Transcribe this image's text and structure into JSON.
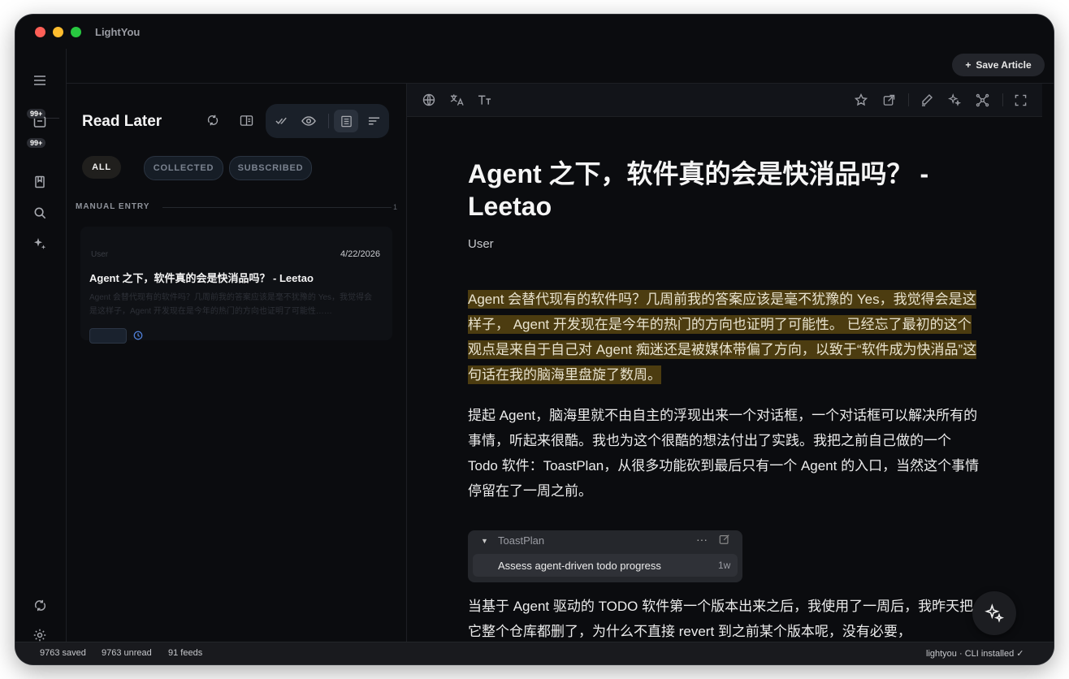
{
  "app": {
    "title": "LightYou"
  },
  "rail": {
    "badge_1": "99+",
    "badge_2": "99+"
  },
  "header": {
    "save_article_label": "Save Article"
  },
  "list": {
    "title": "Read Later",
    "filters": [
      "ALL",
      "COLLECTED",
      "SUBSCRIBED"
    ],
    "section": {
      "label": "MANUAL ENTRY",
      "count": "1"
    },
    "items": [
      {
        "source": "User",
        "date": "4/22/2026",
        "title": "Agent 之下，软件真的会是快消品吗？ - Leetao",
        "excerpt": "Agent 会替代现有的软件吗？几周前我的答案应该是毫不犹豫的 Yes，我觉得会是这样子，Agent 开发现在是今年的热门的方向也证明了可能性……"
      }
    ]
  },
  "article": {
    "title": "Agent 之下，软件真的会是快消品吗？ - Leetao",
    "author": "User",
    "paragraph_1": "Agent 会替代现有的软件吗？几周前我的答案应该是毫不犹豫的 Yes，我觉得会是这样子， Agent 开发现在是今年的热门的方向也证明了可能性。 已经忘了最初的这个观点是来自于自己对 Agent 痴迷还是被媒体带偏了方向，以致于“软件成为快消品”这句话在我的脑海里盘旋了数周。",
    "paragraph_2": "提起 Agent，脑海里就不由自主的浮现出来一个对话框，一个对话框可以解决所有的事情，听起来很酷。我也为这个很酷的想法付出了实践。我把之前自己做的一个 Todo 软件：ToastPlan，从很多功能砍到最后只有一个 Agent 的入口，当然这个事情停留在了一周之前。",
    "embed": {
      "list_name": "ToastPlan",
      "more": "···",
      "task": "Assess agent-driven todo progress",
      "age": "1w"
    },
    "paragraph_3": "当基于 Agent 驱动的 TODO 软件第一个版本出来之后，我使用了一周后，我昨天把它整个仓库都删了，为什么不直接 revert 到之前某个版本呢，没有必要，"
  },
  "status": {
    "saved": "9763 saved",
    "unread": "9763 unread",
    "feeds": "91 feeds",
    "cli": "lightyou · CLI installed ✓"
  },
  "colors": {
    "background": "#0b0c0f",
    "highlight": "#4c3c10",
    "accent": "#4f7fd8"
  }
}
